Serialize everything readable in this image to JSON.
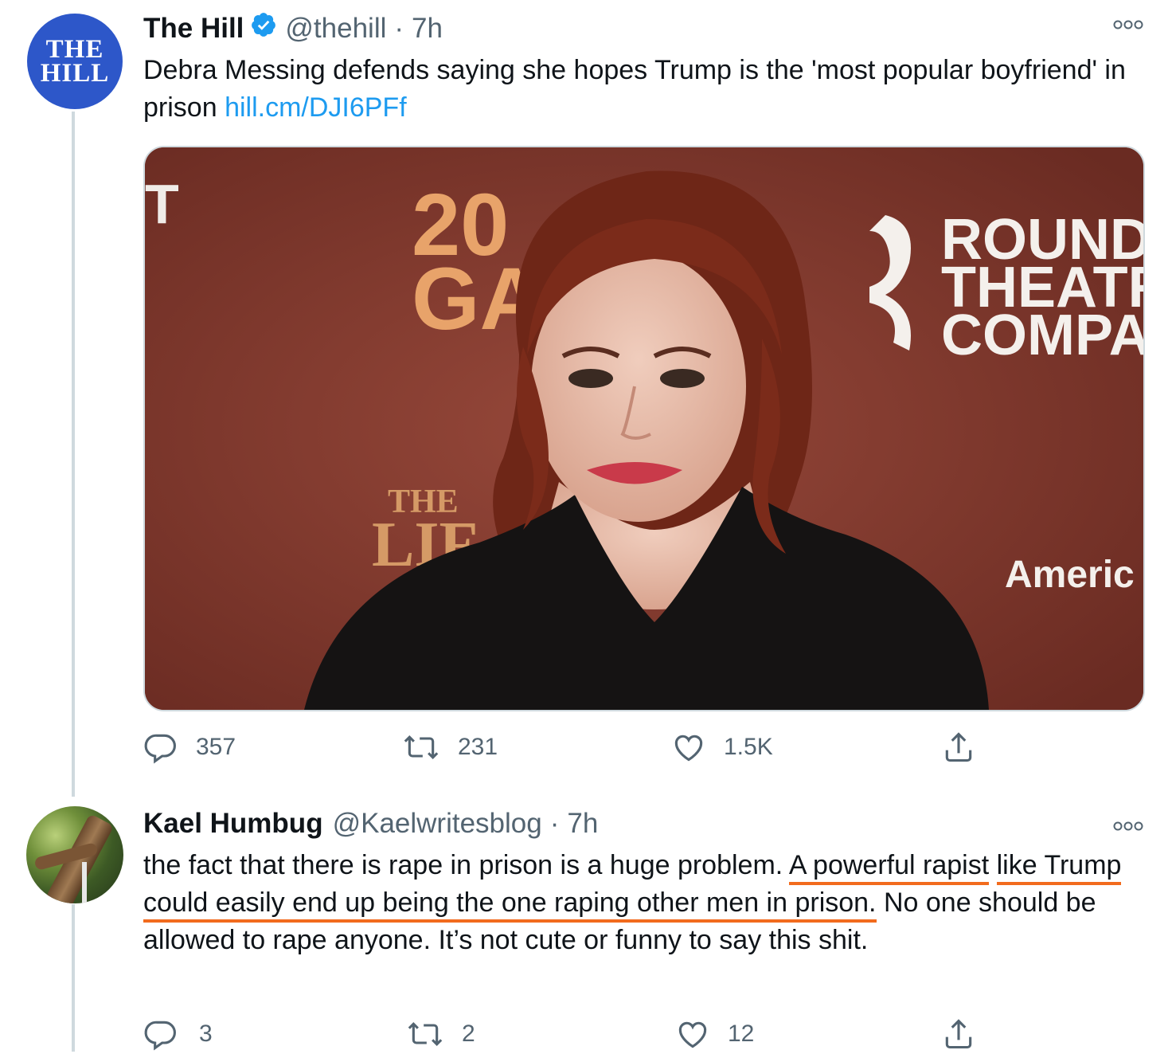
{
  "tweet1": {
    "avatar_text_line1": "THE",
    "avatar_text_line2": "HILL",
    "name": "The Hill",
    "handle": "@thehill",
    "separator": "·",
    "time": "7h",
    "text": "Debra Messing defends saying she hopes Trump is the 'most popular boyfriend' in prison ",
    "link": "hill.cm/DJI6PFf",
    "image": {
      "bg_text_left_1": "20",
      "bg_text_left_2": "GA",
      "bg_text_the": "THE",
      "bg_text_lif": "LIF",
      "bg_text_t": "T",
      "bg_text_round": "ROUND",
      "bg_text_theatre": "THEATRE",
      "bg_text_compan": "COMPAN",
      "bg_text_america": "Americ"
    },
    "replies": "357",
    "retweets": "231",
    "likes": "1.5K"
  },
  "tweet2": {
    "name": "Kael Humbug",
    "handle": "@Kaelwritesblog",
    "separator": "·",
    "time": "7h",
    "text_part1": "the fact that there is rape in prison is a huge problem. ",
    "text_underlined_1": "A powerful rapist",
    "text_underlined_2": "like Trump could easily end up being the one raping other men in prison.",
    "text_part2": " No one should be allowed to rape anyone. It’s not cute or funny to say this shit.",
    "replies": "3",
    "retweets": "2",
    "likes": "12"
  },
  "colors": {
    "link": "#1d9bf0",
    "verified": "#1d9bf0",
    "underline": "#f26b1d",
    "hill_avatar": "#2d57c9",
    "muted": "#536471"
  },
  "icons": [
    "verified-icon",
    "more-icon",
    "reply-icon",
    "retweet-icon",
    "like-icon",
    "share-icon"
  ]
}
